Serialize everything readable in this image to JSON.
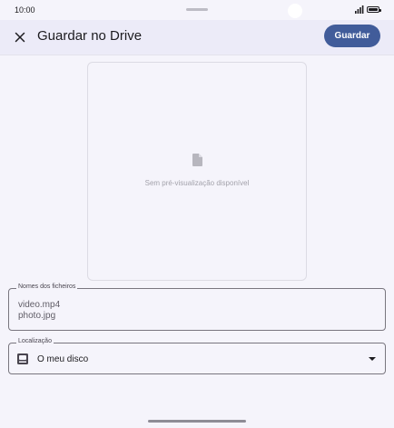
{
  "status_bar": {
    "time": "10:00",
    "icons": [
      "signal-icon",
      "battery-icon"
    ]
  },
  "app_bar": {
    "close_icon": "close-icon",
    "title": "Guardar no Drive",
    "save_label": "Guardar"
  },
  "preview": {
    "icon": "file-icon",
    "message": "Sem pré-visualização disponível"
  },
  "file_names": {
    "label": "Nomes dos ficheiros",
    "line1": "video.mp4",
    "line2": "photo.jpg"
  },
  "location": {
    "label": "Localização",
    "icon": "drive-icon",
    "value": "O meu disco"
  },
  "colors": {
    "accent": "#415c9a",
    "app_bar_bg": "#ecebf8",
    "page_bg": "#f5f4fb"
  }
}
